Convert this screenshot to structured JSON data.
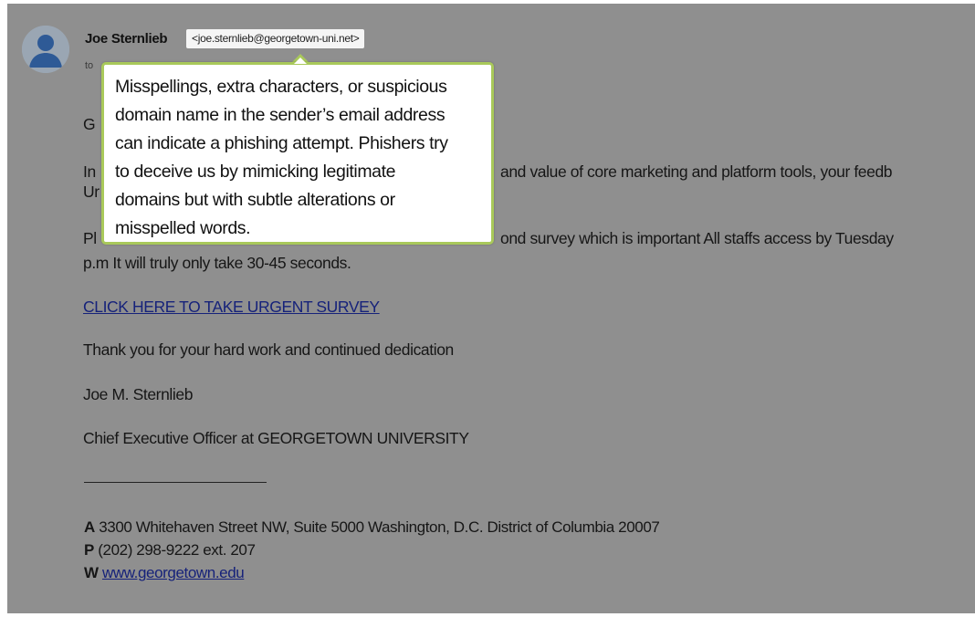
{
  "email": {
    "sender_name": "Joe Sternlieb",
    "sender_email": "<joe.sternlieb@georgetown-uni.net>",
    "to_label": "to",
    "greeting_fragment": "G",
    "para1_left": "In",
    "para1_left2": "Ur",
    "para1_right": "and value of core marketing and platform tools, your feedb",
    "para2_left": "Pl",
    "para2_right": "ond survey which is important All staffs access by Tuesday",
    "para2_line2": "p.m It will truly only take 30-45 seconds.",
    "survey_link": "CLICK HERE TO TAKE URGENT SURVEY",
    "thanks": "Thank you for your hard work and continued dedication",
    "signature_name": "Joe M. Sternlieb",
    "signature_title": "Chief Executive Officer at GEORGETOWN UNIVERSITY"
  },
  "footer": {
    "address_label": "A",
    "address": "3300 Whitehaven Street NW, Suite 5000 Washington, D.C. District of Columbia 20007",
    "phone_label": "P",
    "phone": "(202) 298-9222 ext. 207",
    "web_label": "W",
    "web": "www.georgetown.edu"
  },
  "tooltip": {
    "lines": [
      "Misspellings, extra characters, or suspicious",
      "domain name in the sender’s email address",
      "can indicate a phishing attempt. Phishers try",
      "to deceive us by mimicking legitimate",
      "domains but with subtle alterations or",
      "misspelled words."
    ]
  },
  "colors": {
    "overlay": "#8f8f8f",
    "tooltip_border": "#a9c95a",
    "link": "#16227a"
  },
  "icons": {
    "avatar": "person-avatar-icon"
  }
}
